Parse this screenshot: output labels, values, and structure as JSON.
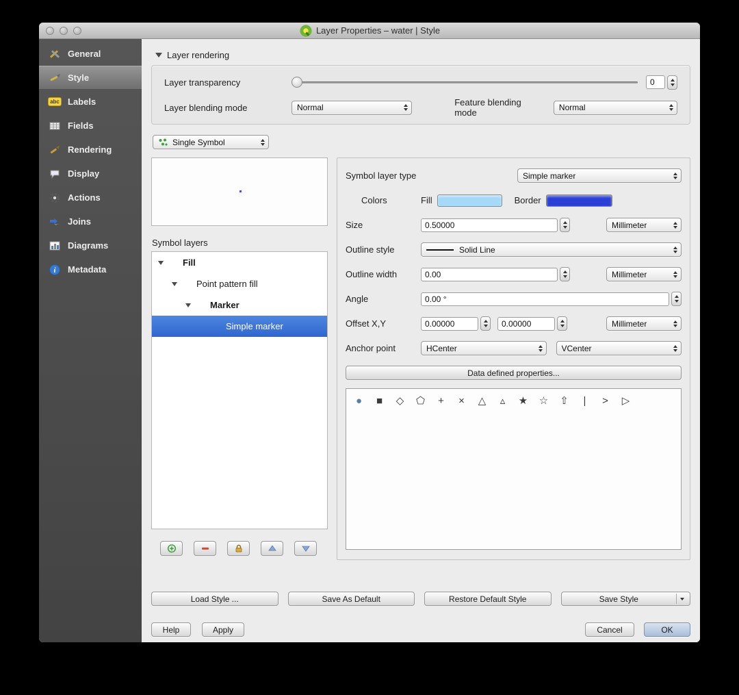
{
  "window": {
    "title": "Layer Properties – water | Style"
  },
  "sidebar": {
    "items": [
      {
        "label": "General"
      },
      {
        "label": "Style"
      },
      {
        "label": "Labels"
      },
      {
        "label": "Fields"
      },
      {
        "label": "Rendering"
      },
      {
        "label": "Display"
      },
      {
        "label": "Actions"
      },
      {
        "label": "Joins"
      },
      {
        "label": "Diagrams"
      },
      {
        "label": "Metadata"
      }
    ]
  },
  "layer_rendering": {
    "header": "Layer rendering",
    "transparency": {
      "label": "Layer transparency",
      "value": "0"
    },
    "blending": {
      "label": "Layer blending mode",
      "value": "Normal"
    },
    "feature_blending": {
      "label": "Feature blending mode",
      "value": "Normal"
    }
  },
  "renderer": {
    "selected": "Single Symbol"
  },
  "symbol_layers": {
    "label": "Symbol layers",
    "tree": [
      {
        "label": "Fill"
      },
      {
        "label": "Point pattern fill"
      },
      {
        "label": "Marker"
      },
      {
        "label": "Simple marker"
      }
    ]
  },
  "marker_props": {
    "type_label": "Symbol layer type",
    "type_value": "Simple marker",
    "colors_label": "Colors",
    "fill_label": "Fill",
    "border_label": "Border",
    "fill_color": "#a6d9f7",
    "border_color": "#2b3fd6",
    "size_label": "Size",
    "size_value": "0.50000",
    "size_unit": "Millimeter",
    "outline_style_label": "Outline style",
    "outline_style_value": "Solid Line",
    "outline_width_label": "Outline width",
    "outline_width_value": "0.00",
    "outline_width_unit": "Millimeter",
    "angle_label": "Angle",
    "angle_value": "0.00 °",
    "offset_label": "Offset X,Y",
    "offset_x": "0.00000",
    "offset_y": "0.00000",
    "offset_unit": "Millimeter",
    "anchor_label": "Anchor point",
    "anchor_h": "HCenter",
    "anchor_v": "VCenter",
    "data_defined_button": "Data defined properties..."
  },
  "marker_shapes": [
    {
      "name": "circle",
      "glyph": "●"
    },
    {
      "name": "square",
      "glyph": "■"
    },
    {
      "name": "diamond",
      "glyph": "◇"
    },
    {
      "name": "pentagon",
      "glyph": "⬠"
    },
    {
      "name": "cross",
      "glyph": "+"
    },
    {
      "name": "cross2",
      "glyph": "×"
    },
    {
      "name": "triangle",
      "glyph": "△"
    },
    {
      "name": "equilateral-triangle",
      "glyph": "▵"
    },
    {
      "name": "star",
      "glyph": "★"
    },
    {
      "name": "regular-star",
      "glyph": "☆"
    },
    {
      "name": "arrow",
      "glyph": "⇧"
    },
    {
      "name": "line",
      "glyph": "|"
    },
    {
      "name": "arrowhead",
      "glyph": ">"
    },
    {
      "name": "filled-arrowhead",
      "glyph": "▷"
    }
  ],
  "footer": {
    "load_style": "Load Style ...",
    "save_as_default": "Save As Default",
    "restore_default_style": "Restore Default Style",
    "save_style": "Save Style",
    "help": "Help",
    "apply": "Apply",
    "cancel": "Cancel",
    "ok": "OK"
  }
}
